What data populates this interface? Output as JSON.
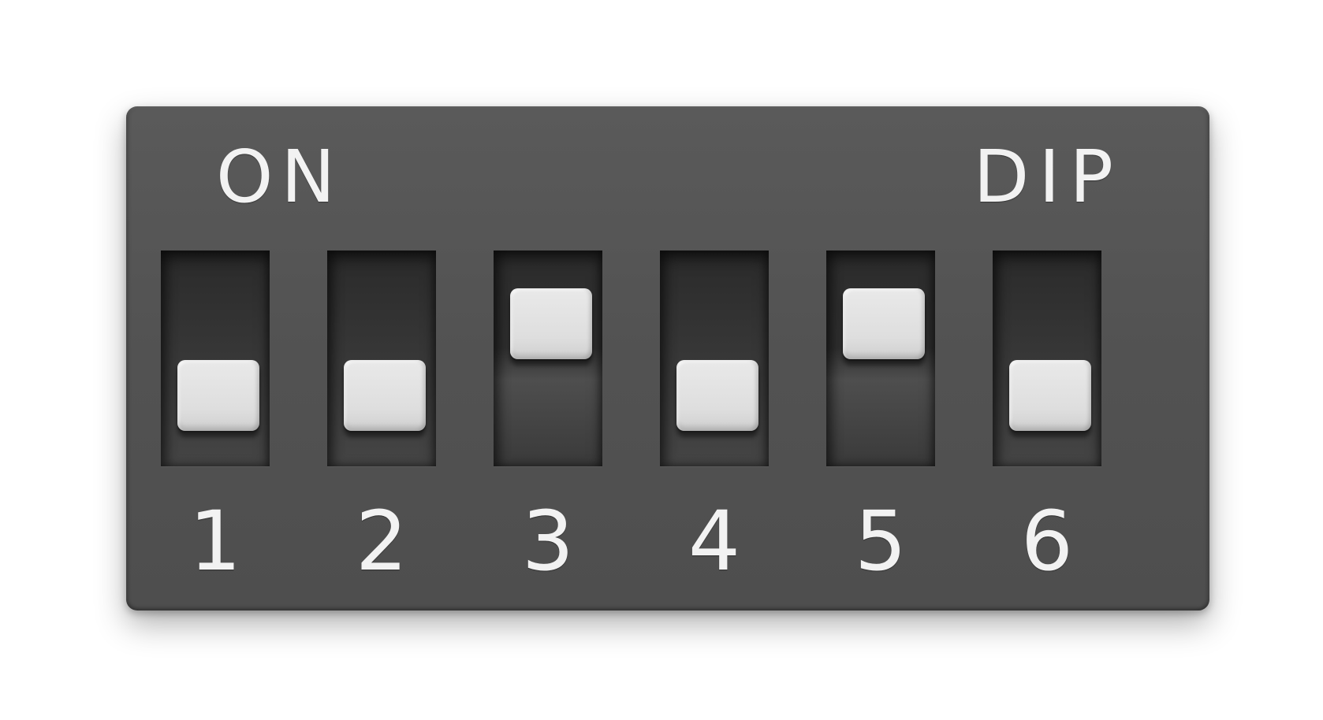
{
  "labels": {
    "on": "ON",
    "dip": "DIP"
  },
  "switches": [
    {
      "number": "1",
      "state": "off"
    },
    {
      "number": "2",
      "state": "off"
    },
    {
      "number": "3",
      "state": "on"
    },
    {
      "number": "4",
      "state": "off"
    },
    {
      "number": "5",
      "state": "on"
    },
    {
      "number": "6",
      "state": "off"
    }
  ],
  "colors": {
    "body": "#555555",
    "slot": "#2e2e2e",
    "knob": "#e0e0e0",
    "text": "#f2f2f2"
  }
}
